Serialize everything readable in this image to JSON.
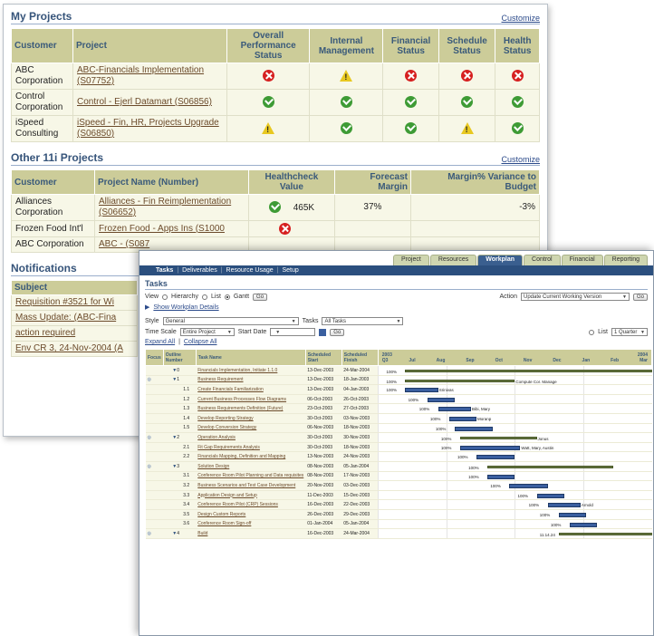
{
  "my_projects": {
    "title": "My Projects",
    "customize": "Customize",
    "headers": [
      "Customer",
      "Project",
      "Overall Performance Status",
      "Internal Management",
      "Financial Status",
      "Schedule Status",
      "Health Status"
    ],
    "rows": [
      {
        "customer": "ABC Corporation",
        "project": "ABC-Financials Implementation (S07752)",
        "status": [
          "red",
          "warn",
          "red",
          "red",
          "red"
        ]
      },
      {
        "customer": "Control Corporation",
        "project": "Control - Ejerl Datamart (S06856)",
        "status": [
          "green",
          "green",
          "green",
          "green",
          "green"
        ]
      },
      {
        "customer": "iSpeed Consulting",
        "project": "iSpeed - Fin, HR, Projects Upgrade (S06850)",
        "status": [
          "warn",
          "green",
          "green",
          "warn",
          "green"
        ]
      }
    ]
  },
  "other_projects": {
    "title": "Other 11i Projects",
    "customize": "Customize",
    "headers": [
      "Customer",
      "Project Name (Number)",
      "Healthcheck Value",
      "Forecast Margin",
      "Margin% Variance to Budget"
    ],
    "rows": [
      {
        "customer": "Alliances Corporation",
        "project": "Alliances - Fin Reimplementation (S06652)",
        "health": "green",
        "value": "465K",
        "margin": "37%",
        "variance": "-3%"
      },
      {
        "customer": "Frozen Food Int'l",
        "project": "Frozen Food - Apps Ins (S1000",
        "health": "red",
        "value": "",
        "margin": "",
        "variance": ""
      },
      {
        "customer": "ABC Corporation",
        "project": "ABC - (S087",
        "health": "",
        "value": "",
        "margin": "",
        "variance": ""
      }
    ]
  },
  "notifications": {
    "title": "Notifications",
    "header": "Subject",
    "rows": [
      "Requisition #3521 for Wi",
      "Mass Update: (ABC-Fina",
      "action required",
      "Env CR 3, 24-Nov-2004 (A"
    ]
  },
  "workplan": {
    "tabs": [
      "Project",
      "Resources",
      "Workplan",
      "Control",
      "Financial",
      "Reporting"
    ],
    "active_tab": "Workplan",
    "subnav": [
      "Tasks",
      "Deliverables",
      "Resource Usage",
      "Setup"
    ],
    "title": "Tasks",
    "view_label": "View",
    "view_options": [
      "Hierarchy",
      "List",
      "Gantt"
    ],
    "go": "Go",
    "show_details": "Show Workplan Details",
    "action_label": "Action",
    "action_value": "Update Current Working Version",
    "style_label": "Style",
    "style_value": "General",
    "tasks_label": "Tasks",
    "tasks_value": "All Tasks",
    "timescale_label": "Time Scale",
    "timescale_value": "Entire Project",
    "startdate_label": "Start Date",
    "list_label": "List",
    "list_value": "1 Quarter",
    "expand_all": "Expand All",
    "collapse_all": "Collapse All",
    "columns": [
      "Focus",
      "Outline Number",
      "Task Name",
      "Scheduled Start",
      "Scheduled Finish"
    ],
    "timeline_years": [
      "2003",
      "2004"
    ],
    "timeline_months": [
      "Q3",
      "Jul",
      "Aug",
      "Sep",
      "Oct",
      "Nov",
      "Dec",
      "Jan",
      "Feb",
      "Mar"
    ],
    "tasks": [
      {
        "num": "0",
        "name": "Financials Implementation, Initiate 1.1.0",
        "start": "13-Dec-2003",
        "finish": "24-Mar-2004"
      },
      {
        "num": "1",
        "name": "Business Requirement",
        "start": "13-Dec-2003",
        "finish": "18-Jan-2003"
      },
      {
        "num": "1.1",
        "name": "Create Financials Familiarization",
        "start": "13-Dec-2003",
        "finish": "04-Jan-2003"
      },
      {
        "num": "1.2",
        "name": "Current Business Processes Flow Diagrams",
        "start": "06-Oct-2003",
        "finish": "26-Oct-2003"
      },
      {
        "num": "1.3",
        "name": "Business Requirements Definition (Future)",
        "start": "23-Oct-2003",
        "finish": "27-Oct-2003"
      },
      {
        "num": "1.4",
        "name": "Develop Reporting Strategy",
        "start": "30-Oct-2003",
        "finish": "03-Nov-2003"
      },
      {
        "num": "1.5",
        "name": "Develop Conversion Strategy",
        "start": "06-Nov-2003",
        "finish": "18-Nov-2003"
      },
      {
        "num": "2",
        "name": "Operation Analysis",
        "start": "30-Oct-2003",
        "finish": "30-Nov-2003"
      },
      {
        "num": "2.1",
        "name": "Fit Gap Requirements Analysis",
        "start": "30-Oct-2003",
        "finish": "18-Nov-2003"
      },
      {
        "num": "2.2",
        "name": "Financials Mapping, Definition and Mapping",
        "start": "13-Nov-2003",
        "finish": "24-Nov-2003"
      },
      {
        "num": "3",
        "name": "Solution Design",
        "start": "08-Nov-2003",
        "finish": "05-Jan-2004"
      },
      {
        "num": "3.1",
        "name": "Conference Room Pilot Planning and Data requisites",
        "start": "08-Nov-2003",
        "finish": "17-Nov-2003"
      },
      {
        "num": "3.2",
        "name": "Business Scenarios and Test Case Development",
        "start": "20-Nov-2003",
        "finish": "03-Dec-2003"
      },
      {
        "num": "3.3",
        "name": "Application Design and Setup",
        "start": "11-Dec-2003",
        "finish": "15-Dec-2003"
      },
      {
        "num": "3.4",
        "name": "Conference Room Pilot (CRP) Sessions",
        "start": "16-Dec-2003",
        "finish": "22-Dec-2003"
      },
      {
        "num": "3.5",
        "name": "Design Custom Reports",
        "start": "26-Dec-2003",
        "finish": "29-Dec-2003"
      },
      {
        "num": "3.6",
        "name": "Conference Room Sign-off",
        "start": "01-Jan-2004",
        "finish": "05-Jan-2004"
      },
      {
        "num": "4",
        "name": "Build",
        "start": "16-Dec-2003",
        "finish": "24-Mar-2004"
      }
    ],
    "bar_labels": [
      "100%",
      "100%",
      "100%",
      "100%",
      "100%",
      "100%",
      "100%",
      "100%",
      "100%",
      "100%",
      "100%",
      "100%",
      "100%",
      "100%",
      "100%",
      "100%",
      "100%",
      "11.14.24"
    ],
    "bar_right_labels": [
      "",
      "Compute Cor. Manage",
      "Srinivas",
      "",
      "Bibi, Mary",
      "Moranp",
      "",
      "Jonus",
      "Watt, Mary, Austin",
      "",
      "",
      "",
      "",
      "",
      "Arnold",
      "",
      "",
      ""
    ]
  }
}
